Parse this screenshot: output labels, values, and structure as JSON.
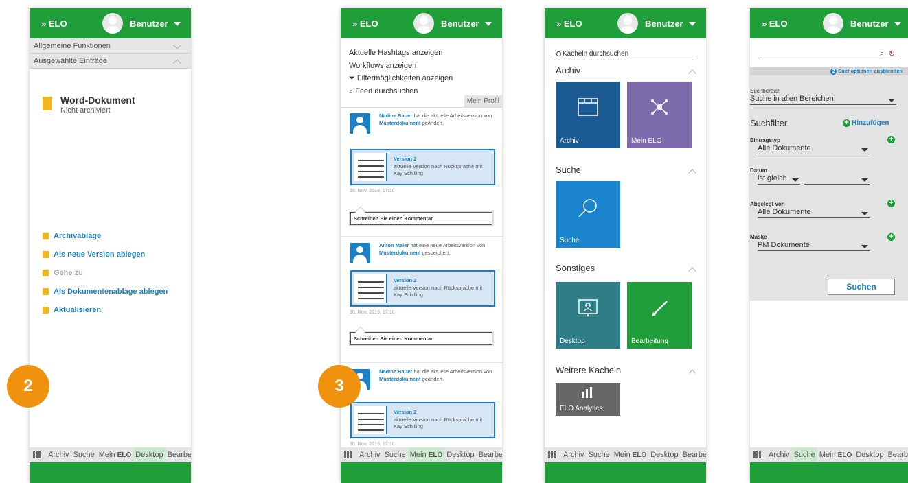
{
  "header": {
    "app": "» ELO",
    "user": "Benutzer"
  },
  "taskbar": {
    "tabs": [
      "Archiv",
      "Suche",
      "Mein",
      "Desktop",
      "Bearbe..."
    ],
    "mein_suffix": "ELO"
  },
  "badges": {
    "panel1": "2",
    "panel2": "3"
  },
  "panel1": {
    "accordion": [
      "Allgemeine Funktionen",
      "Ausgewählte Einträge"
    ],
    "doc_title": "Word-Dokument",
    "doc_status": "Nicht archiviert",
    "actions": [
      "Archivablage",
      "Als neue Version ablegen",
      "Gehe zu",
      "Als Dokumentenablage ablegen",
      "Aktualisieren"
    ]
  },
  "panel2": {
    "menu": [
      "Aktuelle Hashtags anzeigen",
      "Workflows anzeigen",
      "Filtermöglichkeiten anzeigen",
      "Feed durchsuchen"
    ],
    "profile": "Mein Profil",
    "posts": [
      {
        "user": "Nadine Bauer",
        "text": "hat die aktuelle Arbeitsversion von",
        "doc": "Musterdokument",
        "action": "geändert.",
        "version": "Version 2",
        "desc": "aktuelle Version nach Rücksprache mit Kay Schilling",
        "date": "30. Nov. 2019, 17:10",
        "comment": "Schreiben Sie einen Kommentar"
      },
      {
        "user": "Anton Maier",
        "text": "hat eine neue Arbeitsversion von",
        "doc": "Musterdokument",
        "action": "gespeichert.",
        "version": "Version 2",
        "desc": "aktuelle Version nach Rücksprache mit Kay Schilling",
        "date": "30. Nov. 2019, 17:10",
        "comment": "Schreiben Sie einen Kommentar"
      },
      {
        "user": "Nadine Bauer",
        "text": "hat die aktuelle Arbeitsversion von",
        "doc": "Musterdokument",
        "action": "geändert.",
        "version": "Version 2",
        "desc": "aktuelle Version nach Rücksprache mit Kay Schilling",
        "date": "30. Nov. 2019, 17:10"
      }
    ]
  },
  "panel3": {
    "search_placeholder": "Kacheln durchsuchen",
    "sections": [
      "Archiv",
      "Suche",
      "Sonstiges",
      "Weitere Kacheln"
    ],
    "tiles": [
      {
        "label": "Archiv",
        "color": "#1b5a92"
      },
      {
        "label": "Mein ELO",
        "color": "#7b6baa"
      },
      {
        "label": "Suche",
        "color": "#1a85cc"
      },
      {
        "label": "Desktop",
        "color": "#2f7d86"
      },
      {
        "label": "Bearbeitung",
        "color": "#1f9e3a"
      },
      {
        "label": "ELO Analytics",
        "color": "#666666"
      }
    ]
  },
  "panel4": {
    "toggle_num": "2",
    "toggle_label": "Suchoptionen ausblenden",
    "scope_label": "Suchbereich",
    "scope_value": "Suche in allen Bereichen",
    "filter_title": "Suchfilter",
    "add_label": "Hinzufügen",
    "filters": [
      {
        "label": "Eintragstyp",
        "value": "Alle Dokumente"
      },
      {
        "label": "Datum",
        "value": "ist gleich"
      },
      {
        "label": "Abgelegt von",
        "value": "Alle Dokumente"
      },
      {
        "label": "Maske",
        "value": "PM Dokumente"
      }
    ],
    "search_button": "Suchen"
  },
  "colors": {
    "green": "#1f9e3a",
    "blue": "#1a7fc4",
    "badge": "#f0920d"
  }
}
